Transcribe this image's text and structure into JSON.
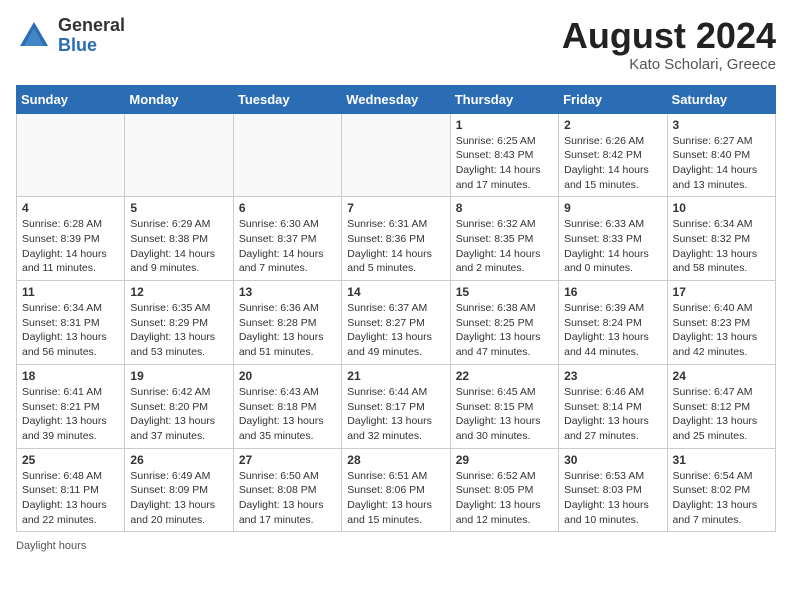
{
  "header": {
    "logo_general": "General",
    "logo_blue": "Blue",
    "month_year": "August 2024",
    "location": "Kato Scholari, Greece"
  },
  "days_of_week": [
    "Sunday",
    "Monday",
    "Tuesday",
    "Wednesday",
    "Thursday",
    "Friday",
    "Saturday"
  ],
  "weeks": [
    [
      {
        "day": "",
        "info": "",
        "empty": true
      },
      {
        "day": "",
        "info": "",
        "empty": true
      },
      {
        "day": "",
        "info": "",
        "empty": true
      },
      {
        "day": "",
        "info": "",
        "empty": true
      },
      {
        "day": "1",
        "info": "Sunrise: 6:25 AM\nSunset: 8:43 PM\nDaylight: 14 hours and 17 minutes."
      },
      {
        "day": "2",
        "info": "Sunrise: 6:26 AM\nSunset: 8:42 PM\nDaylight: 14 hours and 15 minutes."
      },
      {
        "day": "3",
        "info": "Sunrise: 6:27 AM\nSunset: 8:40 PM\nDaylight: 14 hours and 13 minutes."
      }
    ],
    [
      {
        "day": "4",
        "info": "Sunrise: 6:28 AM\nSunset: 8:39 PM\nDaylight: 14 hours and 11 minutes."
      },
      {
        "day": "5",
        "info": "Sunrise: 6:29 AM\nSunset: 8:38 PM\nDaylight: 14 hours and 9 minutes."
      },
      {
        "day": "6",
        "info": "Sunrise: 6:30 AM\nSunset: 8:37 PM\nDaylight: 14 hours and 7 minutes."
      },
      {
        "day": "7",
        "info": "Sunrise: 6:31 AM\nSunset: 8:36 PM\nDaylight: 14 hours and 5 minutes."
      },
      {
        "day": "8",
        "info": "Sunrise: 6:32 AM\nSunset: 8:35 PM\nDaylight: 14 hours and 2 minutes."
      },
      {
        "day": "9",
        "info": "Sunrise: 6:33 AM\nSunset: 8:33 PM\nDaylight: 14 hours and 0 minutes."
      },
      {
        "day": "10",
        "info": "Sunrise: 6:34 AM\nSunset: 8:32 PM\nDaylight: 13 hours and 58 minutes."
      }
    ],
    [
      {
        "day": "11",
        "info": "Sunrise: 6:34 AM\nSunset: 8:31 PM\nDaylight: 13 hours and 56 minutes."
      },
      {
        "day": "12",
        "info": "Sunrise: 6:35 AM\nSunset: 8:29 PM\nDaylight: 13 hours and 53 minutes."
      },
      {
        "day": "13",
        "info": "Sunrise: 6:36 AM\nSunset: 8:28 PM\nDaylight: 13 hours and 51 minutes."
      },
      {
        "day": "14",
        "info": "Sunrise: 6:37 AM\nSunset: 8:27 PM\nDaylight: 13 hours and 49 minutes."
      },
      {
        "day": "15",
        "info": "Sunrise: 6:38 AM\nSunset: 8:25 PM\nDaylight: 13 hours and 47 minutes."
      },
      {
        "day": "16",
        "info": "Sunrise: 6:39 AM\nSunset: 8:24 PM\nDaylight: 13 hours and 44 minutes."
      },
      {
        "day": "17",
        "info": "Sunrise: 6:40 AM\nSunset: 8:23 PM\nDaylight: 13 hours and 42 minutes."
      }
    ],
    [
      {
        "day": "18",
        "info": "Sunrise: 6:41 AM\nSunset: 8:21 PM\nDaylight: 13 hours and 39 minutes."
      },
      {
        "day": "19",
        "info": "Sunrise: 6:42 AM\nSunset: 8:20 PM\nDaylight: 13 hours and 37 minutes."
      },
      {
        "day": "20",
        "info": "Sunrise: 6:43 AM\nSunset: 8:18 PM\nDaylight: 13 hours and 35 minutes."
      },
      {
        "day": "21",
        "info": "Sunrise: 6:44 AM\nSunset: 8:17 PM\nDaylight: 13 hours and 32 minutes."
      },
      {
        "day": "22",
        "info": "Sunrise: 6:45 AM\nSunset: 8:15 PM\nDaylight: 13 hours and 30 minutes."
      },
      {
        "day": "23",
        "info": "Sunrise: 6:46 AM\nSunset: 8:14 PM\nDaylight: 13 hours and 27 minutes."
      },
      {
        "day": "24",
        "info": "Sunrise: 6:47 AM\nSunset: 8:12 PM\nDaylight: 13 hours and 25 minutes."
      }
    ],
    [
      {
        "day": "25",
        "info": "Sunrise: 6:48 AM\nSunset: 8:11 PM\nDaylight: 13 hours and 22 minutes."
      },
      {
        "day": "26",
        "info": "Sunrise: 6:49 AM\nSunset: 8:09 PM\nDaylight: 13 hours and 20 minutes."
      },
      {
        "day": "27",
        "info": "Sunrise: 6:50 AM\nSunset: 8:08 PM\nDaylight: 13 hours and 17 minutes."
      },
      {
        "day": "28",
        "info": "Sunrise: 6:51 AM\nSunset: 8:06 PM\nDaylight: 13 hours and 15 minutes."
      },
      {
        "day": "29",
        "info": "Sunrise: 6:52 AM\nSunset: 8:05 PM\nDaylight: 13 hours and 12 minutes."
      },
      {
        "day": "30",
        "info": "Sunrise: 6:53 AM\nSunset: 8:03 PM\nDaylight: 13 hours and 10 minutes."
      },
      {
        "day": "31",
        "info": "Sunrise: 6:54 AM\nSunset: 8:02 PM\nDaylight: 13 hours and 7 minutes."
      }
    ]
  ],
  "footer": {
    "note": "Daylight hours"
  }
}
